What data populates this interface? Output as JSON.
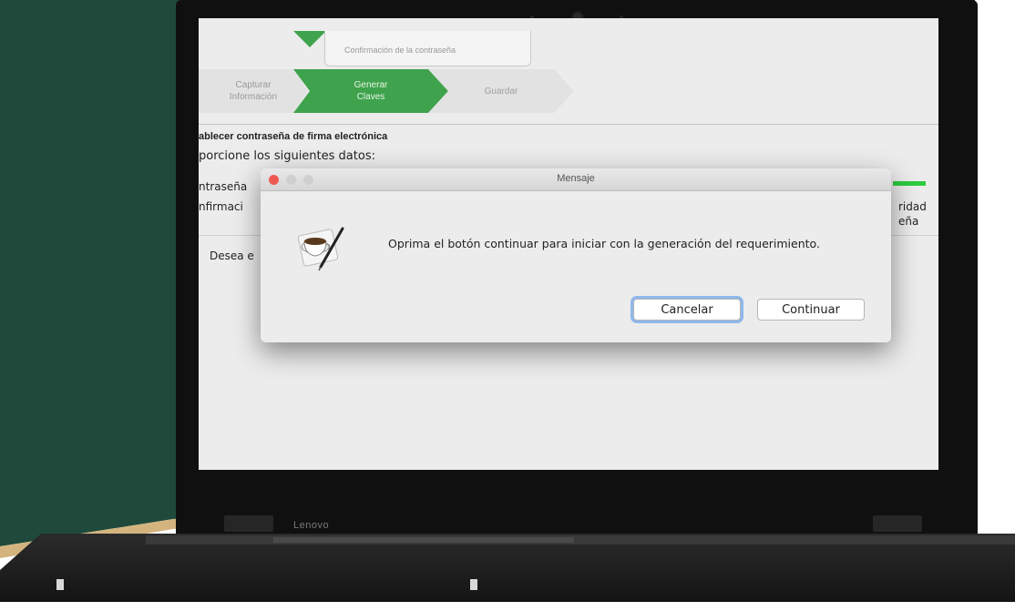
{
  "app": {
    "top_box_text": "Confirmación de la contraseña",
    "steps": [
      {
        "label": "Capturar\nInformación",
        "active": false
      },
      {
        "label": "Generar\nClaves",
        "active": true
      },
      {
        "label": "Guardar",
        "active": false
      }
    ],
    "heading": "ablecer contraseña de firma electrónica",
    "subheading": "porcione los siguientes datos:",
    "password_label": "ntraseña",
    "confirm_label": "nfirmaci",
    "right_label_1": "ridad",
    "right_label_2": "eña",
    "desea_text": "Desea e"
  },
  "dialog": {
    "title": "Mensaje",
    "message": "Oprima el botón continuar para iniciar con la generación del requerimiento.",
    "cancel_label": "Cancelar",
    "continue_label": "Continuar",
    "icon": "coffee-cup-pen-icon"
  },
  "laptop": {
    "brand": "Lenovo"
  },
  "colors": {
    "step_active": "#3fa34d",
    "strength_bar": "#2ecc40",
    "close_button": "#ee5a52",
    "background": "#1f4a3b"
  }
}
